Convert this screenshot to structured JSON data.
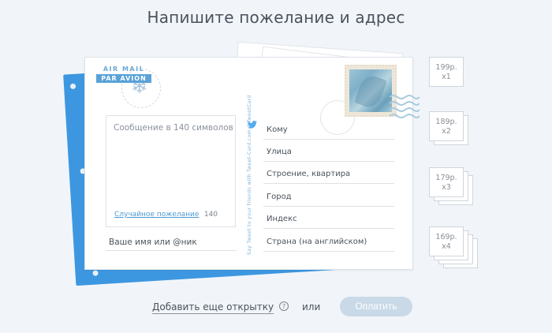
{
  "title": "Напишите пожелание и адрес",
  "postcard": {
    "airmail_line1": "AIR MAIL",
    "airmail_line2": "PAR AVION",
    "message_placeholder": "Сообщение в 140 символов",
    "random_wish": "Случайное пожелание",
    "char_count": "140",
    "name_placeholder": "Ваше имя или @ник",
    "vertical_text": "Say Tweet to your friends with Tweet-Card.com   @TweetCard",
    "address_fields": [
      "Кому",
      "Улица",
      "Строение, квартира",
      "Город",
      "Индекс",
      "Страна (на английском)"
    ]
  },
  "prices": [
    {
      "price": "199р.",
      "qty": "x1"
    },
    {
      "price": "189р.",
      "qty": "x2"
    },
    {
      "price": "179р.",
      "qty": "x3"
    },
    {
      "price": "169р.",
      "qty": "x4"
    }
  ],
  "footer": {
    "add_card": "Добавить еще открытку",
    "help_icon": "?",
    "or": "или",
    "pay": "Оплатить"
  },
  "colors": {
    "accent_blue": "#3d97e0",
    "link_blue": "#4e9ad3",
    "pay_button": "#c9d9e8"
  }
}
